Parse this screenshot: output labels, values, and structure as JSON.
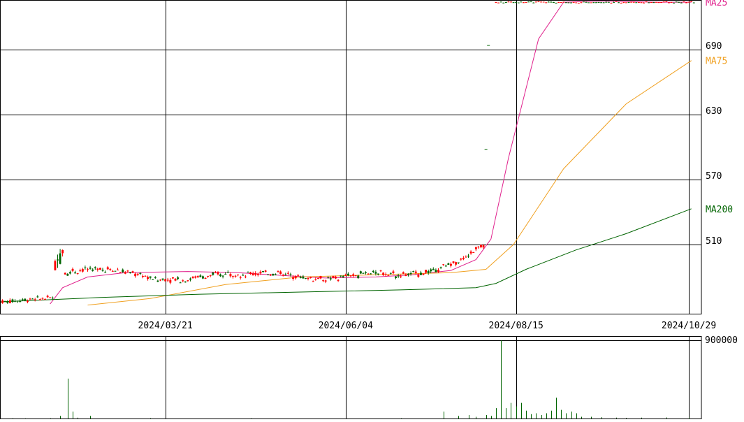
{
  "chart_data": [
    {
      "type": "candlestick",
      "panel": "price",
      "grid": true,
      "x_axis": {
        "tick_labels": [
          "2024/03/21",
          "2024/06/04",
          "2024/08/15",
          "2024/10/29"
        ],
        "tick_index": [
          66,
          138,
          206,
          275
        ],
        "range_index": [
          0,
          280
        ]
      },
      "y_axis": {
        "tick_labels": [
          "510",
          "570",
          "630",
          "690"
        ],
        "tick_values": [
          510,
          570,
          630,
          690
        ],
        "range": [
          446,
          736
        ],
        "position": "right"
      },
      "up_color": "#ff0000",
      "down_color": "#006400",
      "candles": {
        "segments": [
          {
            "start_index": 0,
            "pattern": "low",
            "count": 22
          },
          {
            "start_index": 22,
            "pattern": "spike",
            "count": 4
          },
          {
            "start_index": 26,
            "pattern": "plateau",
            "count": 70
          },
          {
            "start_index": 96,
            "pattern": "range",
            "count": 62
          },
          {
            "start_index": 158,
            "pattern": "rise",
            "count": 36
          },
          {
            "start_index": 194,
            "pattern": "gap",
            "count": 4
          },
          {
            "start_index": 198,
            "pattern": "high",
            "count": 80
          }
        ]
      },
      "moving_averages": [
        {
          "name": "MA25",
          "color": "#e0208c",
          "points": [
            [
              20,
              455
            ],
            [
              25,
              470
            ],
            [
              35,
              480
            ],
            [
              50,
              484
            ],
            [
              75,
              485
            ],
            [
              95,
              484
            ],
            [
              115,
              481
            ],
            [
              130,
              479
            ],
            [
              150,
              480
            ],
            [
              165,
              482
            ],
            [
              180,
              486
            ],
            [
              190,
              496
            ],
            [
              196,
              515
            ],
            [
              203,
              590
            ],
            [
              215,
              700
            ],
            [
              225,
              734
            ],
            [
              240,
              735
            ],
            [
              262,
              734
            ],
            [
              276,
              734
            ]
          ]
        },
        {
          "name": "MA75",
          "color": "#f0a020",
          "points": [
            [
              35,
              454
            ],
            [
              60,
              460
            ],
            [
              90,
              473
            ],
            [
              120,
              480
            ],
            [
              150,
              482
            ],
            [
              180,
              484
            ],
            [
              194,
              487
            ],
            [
              205,
              510
            ],
            [
              225,
              580
            ],
            [
              250,
              640
            ],
            [
              276,
              680
            ]
          ]
        },
        {
          "name": "MA200",
          "color": "#006400",
          "points": [
            [
              0,
              457
            ],
            [
              40,
              461
            ],
            [
              80,
              464
            ],
            [
              120,
              466
            ],
            [
              160,
              468
            ],
            [
              190,
              470
            ],
            [
              198,
              474
            ],
            [
              210,
              487
            ],
            [
              230,
              505
            ],
            [
              250,
              520
            ],
            [
              276,
              543
            ]
          ]
        }
      ],
      "legend": [
        "MA25",
        "MA75",
        "MA200"
      ]
    },
    {
      "type": "bar",
      "panel": "volume",
      "y_axis": {
        "tick_labels": [
          "900000"
        ],
        "tick_values": [
          900000
        ],
        "range": [
          0,
          950000
        ],
        "position": "right"
      },
      "color": "#006400",
      "bars": [
        [
          0,
          2000
        ],
        [
          5,
          3000
        ],
        [
          10,
          2000
        ],
        [
          20,
          3000
        ],
        [
          24,
          30000
        ],
        [
          27,
          460000
        ],
        [
          29,
          80000
        ],
        [
          31,
          10000
        ],
        [
          36,
          30000
        ],
        [
          60,
          4000
        ],
        [
          100,
          3000
        ],
        [
          160,
          3000
        ],
        [
          177,
          80000
        ],
        [
          183,
          30000
        ],
        [
          187,
          40000
        ],
        [
          190,
          20000
        ],
        [
          194,
          40000
        ],
        [
          196,
          30000
        ],
        [
          198,
          120000
        ],
        [
          200,
          900000
        ],
        [
          202,
          120000
        ],
        [
          204,
          180000
        ],
        [
          206,
          140000
        ],
        [
          208,
          180000
        ],
        [
          210,
          90000
        ],
        [
          212,
          50000
        ],
        [
          214,
          60000
        ],
        [
          216,
          40000
        ],
        [
          218,
          60000
        ],
        [
          220,
          90000
        ],
        [
          222,
          240000
        ],
        [
          224,
          100000
        ],
        [
          226,
          60000
        ],
        [
          228,
          80000
        ],
        [
          230,
          60000
        ],
        [
          232,
          20000
        ],
        [
          236,
          20000
        ],
        [
          240,
          15000
        ],
        [
          246,
          10000
        ],
        [
          250,
          8000
        ],
        [
          256,
          10000
        ],
        [
          266,
          12000
        ],
        [
          275,
          12000
        ]
      ]
    }
  ]
}
